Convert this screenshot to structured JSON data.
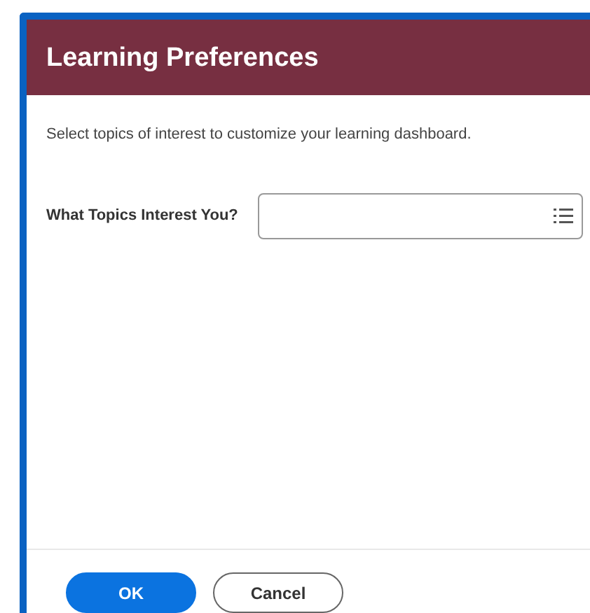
{
  "dialog": {
    "title": "Learning Preferences",
    "instructions": "Select topics of interest to customize your learning dashboard.",
    "field": {
      "label": "What Topics Interest You?"
    },
    "buttons": [
      {
        "label": "OK",
        "kind": "primary"
      },
      {
        "label": "Cancel",
        "kind": "secondary"
      }
    ]
  }
}
